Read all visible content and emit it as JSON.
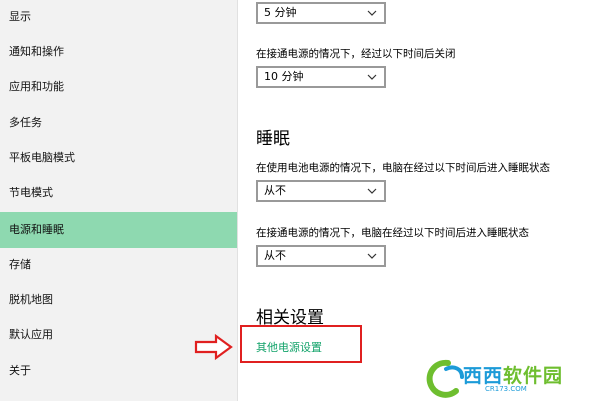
{
  "sidebar": {
    "items": [
      {
        "label": "显示"
      },
      {
        "label": "通知和操作"
      },
      {
        "label": "应用和功能"
      },
      {
        "label": "多任务"
      },
      {
        "label": "平板电脑模式"
      },
      {
        "label": "节电模式"
      },
      {
        "label": "电源和睡眠"
      },
      {
        "label": "存储"
      },
      {
        "label": "脱机地图"
      },
      {
        "label": "默认应用"
      },
      {
        "label": "关于"
      }
    ],
    "active_index": 6,
    "active_color": "#8ed9b0"
  },
  "screen": {
    "battery_value": "5 分钟",
    "plugged_desc": "在接通电源的情况下，经过以下时间后关闭",
    "plugged_value": "10 分钟"
  },
  "sleep": {
    "heading": "睡眠",
    "battery_desc": "在使用电池电源的情况下，电脑在经过以下时间后进入睡眠状态",
    "battery_value": "从不",
    "plugged_desc": "在接通电源的情况下，电脑在经过以下时间后进入睡眠状态",
    "plugged_value": "从不"
  },
  "related": {
    "heading": "相关设置",
    "link": "其他电源设置",
    "link_color": "#12a36a"
  },
  "annotation": {
    "highlight_color": "#e02020",
    "arrow_icon": "right-arrow-icon"
  },
  "watermark": {
    "brand_blue": "西西",
    "brand_green": "软件园",
    "site": "CR173.COM"
  }
}
